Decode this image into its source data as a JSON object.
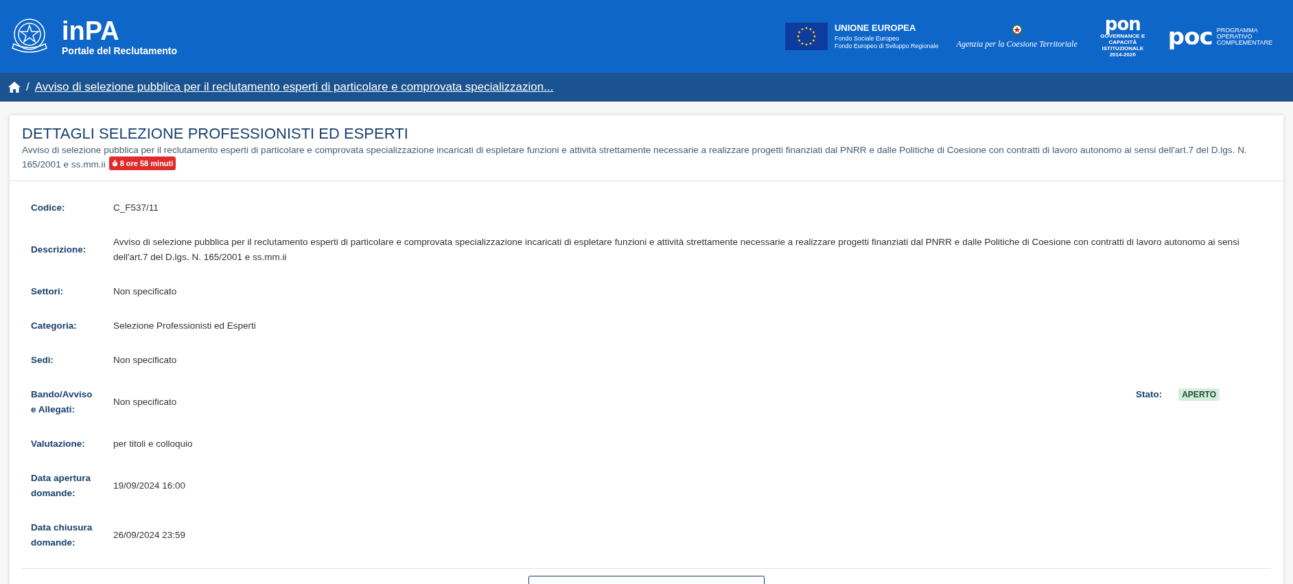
{
  "header": {
    "title": "inPA",
    "subtitle": "Portale del Reclutamento",
    "eu": {
      "title": "UNIONE EUROPEA",
      "lines": [
        "Fondo Sociale Europeo",
        "Fondo Europeo di Sviluppo Regionale"
      ]
    },
    "agency": "Agenzia per la Coesione Territoriale",
    "pon": {
      "mark": "pon",
      "caption": "GOVERNANCE E CAPACITÀ ISTITUZIONALE 2014-2020"
    },
    "poc": {
      "mark": "poc",
      "lines": [
        "PROGRAMMA",
        "OPERATIVO",
        "COMPLEMENTARE"
      ]
    }
  },
  "breadcrumb": {
    "separator": "/",
    "items": [
      "Avviso di selezione pubblica per il reclutamento esperti di particolare e comprovata specializzazion..."
    ]
  },
  "card": {
    "title": "DETTAGLI SELEZIONE PROFESSIONISTI ED ESPERTI",
    "subtitle": "Avviso di selezione pubblica per il reclutamento esperti di particolare e comprovata specializzazione incaricati di espletare funzioni e attività strettamente necessarie a realizzare progetti finanziati dal PNRR e dalle Politiche di Coesione con contratti di lavoro autonomo ai sensi dell'art.7 del D.lgs. N. 165/2001 e ss.mm.ii",
    "timer": "8 ore 58 minuti",
    "fields": [
      {
        "label": "Codice:",
        "value": "C_F537/11"
      },
      {
        "label": "Descrizione:",
        "value": "Avviso di selezione pubblica per il reclutamento esperti di particolare e comprovata specializzazione incaricati di espletare funzioni e attività strettamente necessarie a realizzare progetti finanziati dal PNRR e dalle Politiche di Coesione con contratti di lavoro autonomo ai sensi dell'art.7 del D.lgs. N. 165/2001 e ss.mm.ii"
      },
      {
        "label": "Settori:",
        "value": "Non specificato"
      },
      {
        "label": "Categoria:",
        "value": "Selezione Professionisti ed Esperti"
      },
      {
        "label": "Sedi:",
        "value": "Non specificato"
      },
      {
        "label": "Bando/Avviso e Allegati:",
        "value": "Non specificato",
        "status": {
          "label": "Stato:",
          "value": "APERTO"
        }
      },
      {
        "label": "Valutazione:",
        "value": "per titoli e colloquio"
      },
      {
        "label": "Data apertura domande:",
        "value": "19/09/2024 16:00"
      },
      {
        "label": "Data chiusura domande:",
        "value": "26/09/2024 23:59"
      }
    ]
  }
}
